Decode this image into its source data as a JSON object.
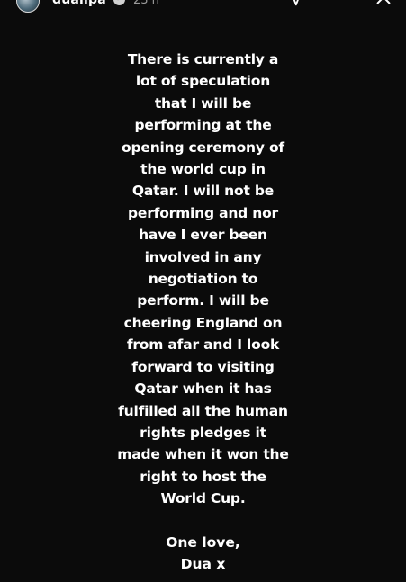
{
  "header": {
    "username": "dualipa",
    "timestamp": "23 h",
    "icons": [
      "avatar",
      "verified-badge-icon",
      "send-icon",
      "more-options-icon",
      "close-icon"
    ]
  },
  "story": {
    "message": "There is currently a\nlot of speculation\nthat I will be\nperforming at the\nopening ceremony of\nthe world cup in\nQatar. I will not be\nperforming and nor\nhave I ever been\ninvolved in any\nnegotiation to\nperform. I will be\ncheering England on\nfrom afar and I look\nforward to visiting\nQatar when it has\nfulfilled all the human\nrights pledges it\nmade when it won the\nright to host the\nWorld Cup.",
    "signoff": "One love,\nDua x"
  },
  "colors": {
    "background": "#0b0b0b",
    "text": "#ffffff",
    "muted": "#9a9a9a"
  }
}
